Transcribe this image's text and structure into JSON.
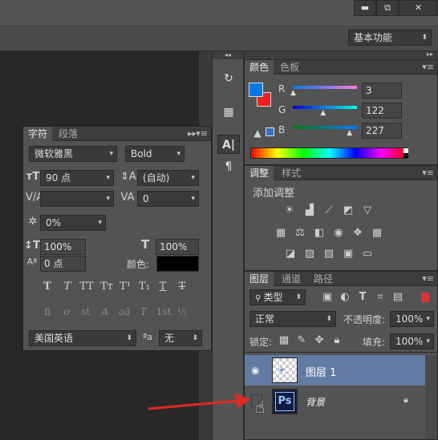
{
  "window": {
    "minimize": "▬",
    "restore": "⧉",
    "close": "✕"
  },
  "workspace": {
    "value": "基本功能"
  },
  "color_panel": {
    "tabs": [
      "颜色",
      "色板"
    ],
    "r_label": "R",
    "g_label": "G",
    "b_label": "B",
    "r": "3",
    "g": "122",
    "b": "227",
    "r_fraction": 0.012,
    "g_fraction": 0.478,
    "b_fraction": 0.89,
    "foreground": "#037ae3",
    "background": "#e8211c"
  },
  "adjust_panel": {
    "tabs": [
      "调整",
      "样式"
    ],
    "title": "添加调整"
  },
  "layers_panel": {
    "tabs": [
      "图层",
      "通道",
      "路径"
    ],
    "filter_kind": "类型",
    "blend_mode": "正常",
    "opacity_label": "不透明度:",
    "opacity": "100%",
    "lock_label": "锁定:",
    "fill_label": "填充:",
    "fill": "100%",
    "layers": [
      {
        "name": "图层 1",
        "visible": true,
        "selected": true
      },
      {
        "name": "背景",
        "visible": false,
        "selected": false,
        "locked": true
      }
    ],
    "ps_badge": "Ps"
  },
  "char_panel": {
    "tabs": [
      "字符",
      "段落"
    ],
    "font_family": "微软雅黑",
    "font_style": "Bold",
    "font_size": "90 点",
    "leading": "(自动)",
    "kerning": "",
    "tracking": "0",
    "tsume": "0%",
    "vscale": "100%",
    "hscale": "100%",
    "baseline": "0 点",
    "color_label": "颜色:",
    "style_buttons": [
      "T",
      "T",
      "TT",
      "Tт",
      "T¹",
      "T₁",
      "T",
      "T"
    ],
    "opentype_buttons": [
      "fi",
      "ơ",
      "st",
      "A",
      "aā",
      "T",
      "1st",
      "½"
    ],
    "language": "美国英语",
    "aa_label": "ªa",
    "antialias": "无"
  },
  "dock": {
    "icons": [
      "history-icon",
      "properties-icon",
      "character-icon",
      "paragraph-icon"
    ]
  },
  "colors": {
    "panel": "#535353",
    "dark": "#282828",
    "accent_red": "#e8211c",
    "accent_blue": "#037ae3"
  }
}
